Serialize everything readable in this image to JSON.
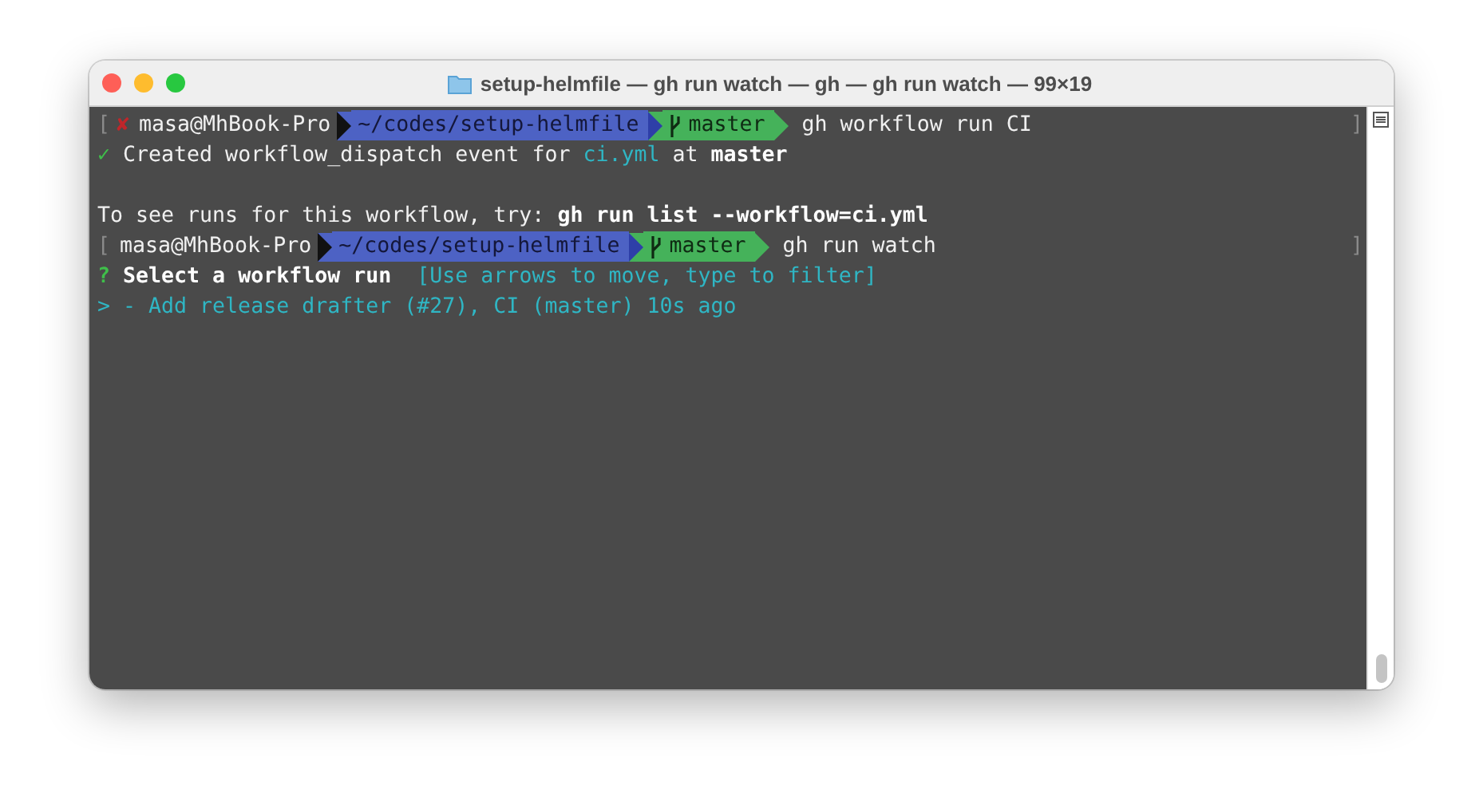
{
  "window": {
    "title": "setup-helmfile — gh run watch — gh — gh run watch — 99×19"
  },
  "lines": [
    {
      "kind": "prompt",
      "mark_left": "[",
      "mark_right": "]",
      "status_icon": "✘",
      "user": "masa@MhBook-Pro",
      "path": "~/codes/setup-helmfile",
      "branch": "master",
      "command": "gh workflow run CI"
    },
    {
      "kind": "output",
      "segments": [
        {
          "text": "✓",
          "kind": "success"
        },
        {
          "text": "Created workflow_dispatch event for",
          "kind": "plain"
        },
        {
          "text": "ci.yml",
          "kind": "highlight"
        },
        {
          "text": "at",
          "kind": "plain"
        },
        {
          "text": "master",
          "kind": "emphasis"
        }
      ]
    },
    {
      "kind": "blank"
    },
    {
      "kind": "output",
      "segments": [
        {
          "text": "To see runs for this workflow, try:",
          "kind": "plain"
        },
        {
          "text": "gh run list --workflow=ci.yml",
          "kind": "emphasis"
        }
      ]
    },
    {
      "kind": "prompt",
      "mark_left": "[",
      "mark_right": "]",
      "user": "masa@MhBook-Pro",
      "path": "~/codes/setup-helmfile",
      "branch": "master",
      "command": "gh run watch"
    },
    {
      "kind": "output",
      "segments": [
        {
          "text": "?",
          "kind": "question"
        },
        {
          "text": "Select a workflow run",
          "kind": "emphasis"
        },
        {
          "text": " [Use arrows to move, type to filter]",
          "kind": "highlight"
        }
      ]
    },
    {
      "kind": "output",
      "segments": [
        {
          "text": "> - Add release drafter (#27), CI (master) 10s ago",
          "kind": "highlight"
        }
      ]
    }
  ]
}
